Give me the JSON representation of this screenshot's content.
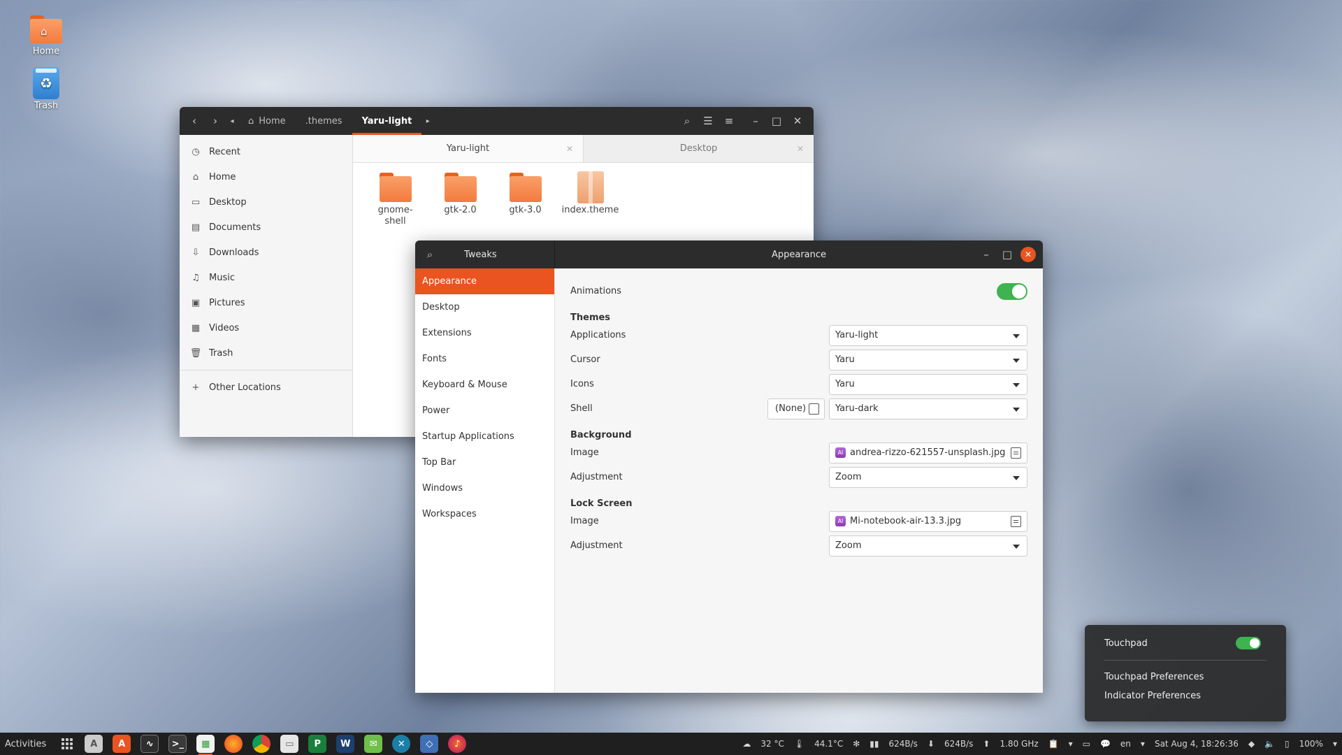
{
  "desktop": {
    "icons": [
      {
        "label": "Home"
      },
      {
        "label": "Trash"
      }
    ]
  },
  "files_window": {
    "breadcrumbs": [
      "Home",
      ".themes",
      "Yaru-light"
    ],
    "sidebar": [
      "Recent",
      "Home",
      "Desktop",
      "Documents",
      "Downloads",
      "Music",
      "Pictures",
      "Videos",
      "Trash",
      "Other Locations"
    ],
    "tabs": [
      "Yaru-light",
      "Desktop"
    ],
    "items": [
      {
        "name": "gnome-\nshell",
        "type": "folder"
      },
      {
        "name": "gtk-2.0",
        "type": "folder"
      },
      {
        "name": "gtk-3.0",
        "type": "folder"
      },
      {
        "name": "index.theme",
        "type": "file"
      }
    ]
  },
  "tweaks_window": {
    "app_title": "Tweaks",
    "page_title": "Appearance",
    "sidebar": [
      "Appearance",
      "Desktop",
      "Extensions",
      "Fonts",
      "Keyboard & Mouse",
      "Power",
      "Startup Applications",
      "Top Bar",
      "Windows",
      "Workspaces"
    ],
    "active_sidebar": "Appearance",
    "animations_label": "Animations",
    "animations_on": true,
    "themes": {
      "heading": "Themes",
      "applications_label": "Applications",
      "applications_value": "Yaru-light",
      "cursor_label": "Cursor",
      "cursor_value": "Yaru",
      "icons_label": "Icons",
      "icons_value": "Yaru",
      "shell_label": "Shell",
      "shell_none": "(None)",
      "shell_value": "Yaru-dark"
    },
    "background": {
      "heading": "Background",
      "image_label": "Image",
      "image_value": "andrea-rizzo-621557-unsplash.jpg",
      "adjustment_label": "Adjustment",
      "adjustment_value": "Zoom"
    },
    "lock_screen": {
      "heading": "Lock Screen",
      "image_label": "Image",
      "image_value": "Mi-notebook-air-13.3.jpg",
      "adjustment_label": "Adjustment",
      "adjustment_value": "Zoom"
    }
  },
  "touchpad_popover": {
    "touchpad_label": "Touchpad",
    "touchpad_on": true,
    "items": [
      "Touchpad Preferences",
      "Indicator Preferences"
    ]
  },
  "panel": {
    "activities": "Activities",
    "weather": "32 °C",
    "cpu_temp": "44.1°C",
    "net_down": "624B/s",
    "net_up": "624B/s",
    "cpu_freq": "1.80 GHz",
    "lang": "en",
    "clock": "Sat Aug  4, 18:26:36",
    "battery": "100%"
  },
  "colors": {
    "accent": "#e95420",
    "toggle_on": "#3eb34f",
    "titlebar": "#2c2c2c"
  }
}
